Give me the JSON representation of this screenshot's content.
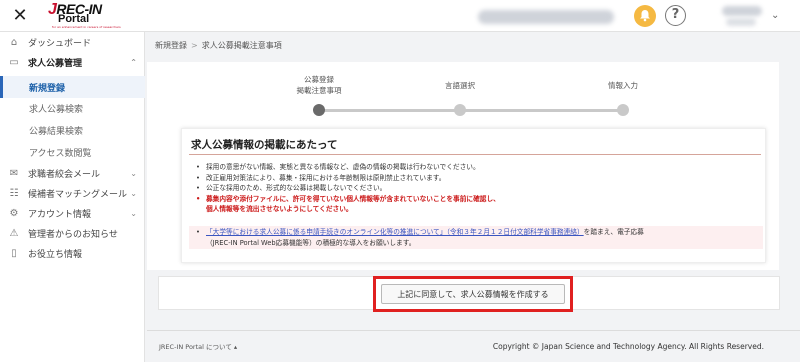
{
  "header": {
    "close_icon": "close-icon",
    "logo": {
      "top": "REC-IN",
      "j": "J",
      "bottom": "Portal",
      "tag": "for an enhancement in careers of researchers"
    },
    "bell_icon": "bell-icon",
    "help_label": "?",
    "caret": "⌄"
  },
  "sidebar": {
    "items": [
      {
        "icon": "home-icon",
        "label": "ダッシュボード"
      },
      {
        "icon": "document-icon",
        "label": "求人公募管理",
        "chevron": "⌃"
      },
      {
        "icon": "mail-icon",
        "label": "求職者絞会メール",
        "chevron": "⌄"
      },
      {
        "icon": "users-icon",
        "label": "候補者マッチングメール",
        "chevron": "⌄"
      },
      {
        "icon": "settings-icon",
        "label": "アカウント情報",
        "chevron": "⌄"
      },
      {
        "icon": "warning-icon",
        "label": "管理者からのお知らせ"
      },
      {
        "icon": "book-icon",
        "label": "お役立ち情報"
      }
    ],
    "subitems": [
      {
        "label": "新規登録",
        "active": true
      },
      {
        "label": "求人公募検索"
      },
      {
        "label": "公募結果検索"
      },
      {
        "label": "アクセス数閲覧"
      }
    ]
  },
  "breadcrumb": {
    "root": "新規登録",
    "sep": ">",
    "current": "求人公募掲載注意事項"
  },
  "stepper": {
    "step1": "公募登録\n掲載注意事項",
    "step1_line1": "公募登録",
    "step1_line2": "掲載注意事項",
    "step2": "言語選択",
    "step3": "情報入力",
    "current_step": 1
  },
  "notice": {
    "title": "求人公募情報の掲載にあたって",
    "items": [
      "採用の意思がない情報、実態と異なる情報など、虚偽の情報の掲載は行わないでください。",
      "改正雇用対策法により、募集・採用における年齢制限は原則禁止されています。",
      "公正な採用のため、形式的な公募は掲載しないでください。"
    ],
    "warning_line1": "募集内容や添付ファイルに、許可を得ていない個人情報等が含まれていないことを事前に確認し、",
    "warning_line2": "個人情報等を流出させないようにしてください。",
    "link_text": "「大学等における求人公募に係る申請手続きのオンライン化等の推進について」（令和３年２月１２日付文部科学省事務連絡）",
    "link_suffix": "を踏まえ、電子応募",
    "line2": "（JREC-IN Portal Web応募機能等）の積極的な導入をお願いします。"
  },
  "agree_button": "上記に同意して、求人公募情報を作成する",
  "footer": {
    "about": "JREC-IN Portal について ▴",
    "copyright": "Copyright © Japan Science and Technology Agency. All Rights Reserved."
  },
  "colors": {
    "accent": "#2a66b8",
    "highlight_frame": "#e02020",
    "warning_text": "#cc1a1a",
    "bell": "#f5b942"
  }
}
